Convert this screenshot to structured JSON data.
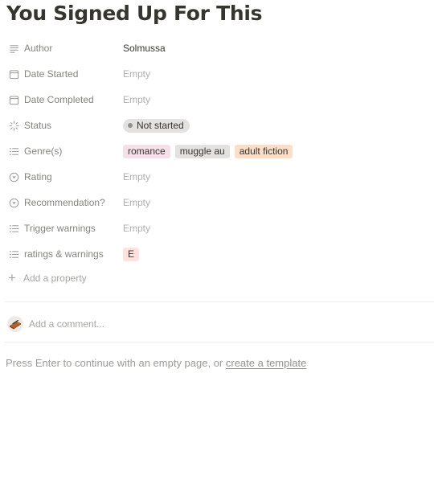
{
  "page": {
    "title": "You Signed Up For This"
  },
  "properties": [
    {
      "icon": "text-lines-icon",
      "label": "Author",
      "type": "text",
      "value": "Solmussa"
    },
    {
      "icon": "calendar-icon",
      "label": "Date Started",
      "type": "empty",
      "value": "Empty"
    },
    {
      "icon": "calendar-icon",
      "label": "Date Completed",
      "type": "empty",
      "value": "Empty"
    },
    {
      "icon": "status-spinner-icon",
      "label": "Status",
      "type": "status",
      "value": "Not started",
      "color": "#e3e2e0",
      "dot": "#91918e"
    },
    {
      "icon": "multi-select-icon",
      "label": "Genre(s)",
      "type": "tags",
      "tags": [
        {
          "label": "romance",
          "color": "#f5e0e9"
        },
        {
          "label": "muggle au",
          "color": "#e3e2e0"
        },
        {
          "label": "adult fiction",
          "color": "#fadec9"
        }
      ]
    },
    {
      "icon": "select-icon",
      "label": "Rating",
      "type": "empty",
      "value": "Empty"
    },
    {
      "icon": "select-icon",
      "label": "Recommendation?",
      "type": "empty",
      "value": "Empty"
    },
    {
      "icon": "multi-select-icon",
      "label": "Trigger warnings",
      "type": "empty",
      "value": "Empty"
    },
    {
      "icon": "multi-select-icon",
      "label": "ratings & warnings",
      "type": "tags",
      "tags": [
        {
          "label": "E",
          "color": "#ffe2dd"
        }
      ]
    }
  ],
  "add_property": {
    "icon": "plus-icon",
    "label": "Add a property"
  },
  "comment": {
    "placeholder": "Add a comment...",
    "avatar": "user-avatar"
  },
  "hint": {
    "prefix": "Press Enter to continue with an empty page, or ",
    "link": "create a template"
  }
}
